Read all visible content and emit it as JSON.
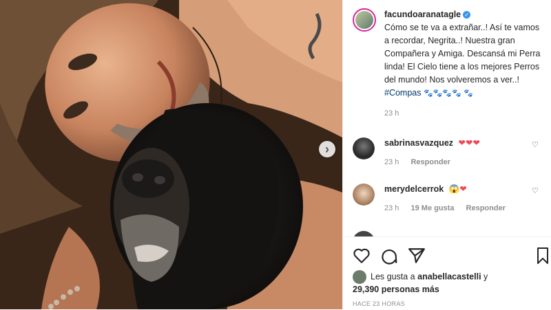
{
  "post": {
    "author": "facundoaranatagle",
    "verified_mark": "✓",
    "caption_text": "Cómo se te va a extrañar..! Así te vamos a recordar, Negrita..! Nuestra gran Compañera y Amiga. Descansá mi Perra linda! El Cielo tiene a los mejores Perros del mundo! Nos volveremos a ver..! ",
    "hashtag": "#Compas",
    "caption_emojis": "🐾🐾🐾🐾",
    "caption_emoji_tail": "🐾",
    "caption_time": "23 h"
  },
  "comments": [
    {
      "user": "sabrinasvazquez",
      "text": "❤❤❤",
      "time": "23 h",
      "likes": "",
      "reply": "Responder",
      "avatar_color": "#2a2a2a"
    },
    {
      "user": "merydelcerrok",
      "text": "😱❤",
      "time": "23 h",
      "likes": "19 Me gusta",
      "reply": "Responder",
      "avatar_color": "#c9a98a"
    }
  ],
  "actions": {
    "icons": [
      "heart-icon",
      "comment-icon",
      "share-icon",
      "bookmark-icon"
    ]
  },
  "likes": {
    "prefix": "Les gusta a",
    "user": "anabellacastelli",
    "suffix": "y",
    "count": "29,390 personas más"
  },
  "timestamp": "HACE 23 HORAS",
  "carousel": {
    "next_glyph": "›"
  },
  "colors": {
    "link": "#00376b",
    "muted": "#8e8e8e",
    "verified": "#3897f0",
    "heart": "#ed4956"
  }
}
